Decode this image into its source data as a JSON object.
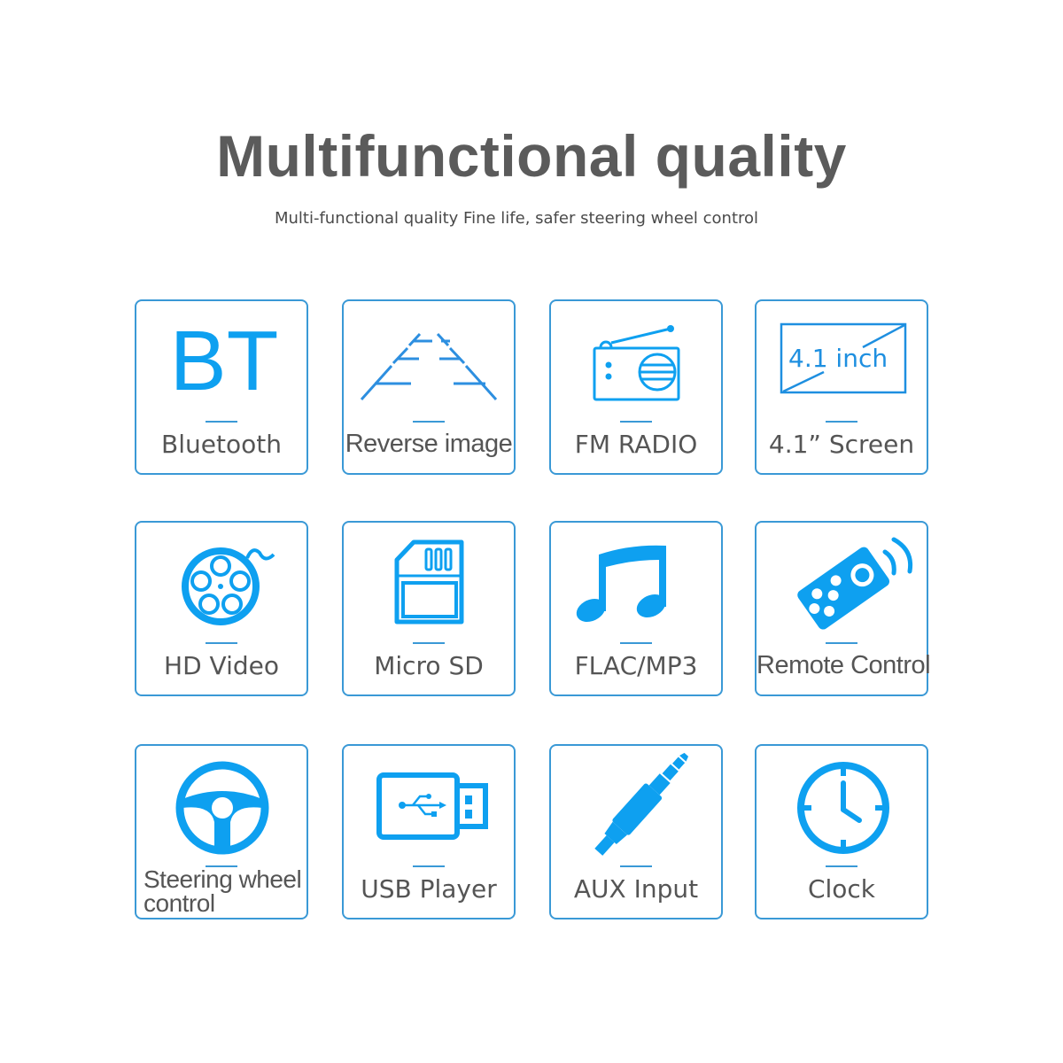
{
  "header": {
    "title": "Multifunctional quality",
    "subtitle": "Multi-functional quality Fine life, safer steering wheel control"
  },
  "colors": {
    "accent": "#0ea0f0",
    "border": "#3a99d6",
    "text": "#555555"
  },
  "features": [
    {
      "label": "Bluetooth",
      "icon": "bluetooth-bt-icon",
      "icon_text": "BT"
    },
    {
      "label": "Reverse image",
      "icon": "reverse-camera-lines-icon"
    },
    {
      "label": "FM RADIO",
      "icon": "radio-icon"
    },
    {
      "label": "4.1”  Screen",
      "icon": "screen-size-icon",
      "icon_text": "4.1 inch"
    },
    {
      "label": "HD Video",
      "icon": "film-reel-icon"
    },
    {
      "label": "Micro SD",
      "icon": "sd-card-icon"
    },
    {
      "label": "FLAC/MP3",
      "icon": "music-note-icon"
    },
    {
      "label": "Remote Control",
      "icon": "remote-control-icon"
    },
    {
      "label": "Steering wheel control",
      "icon": "steering-wheel-icon"
    },
    {
      "label": "USB Player",
      "icon": "usb-drive-icon"
    },
    {
      "label": "AUX Input",
      "icon": "aux-jack-icon"
    },
    {
      "label": "Clock",
      "icon": "clock-icon"
    }
  ]
}
